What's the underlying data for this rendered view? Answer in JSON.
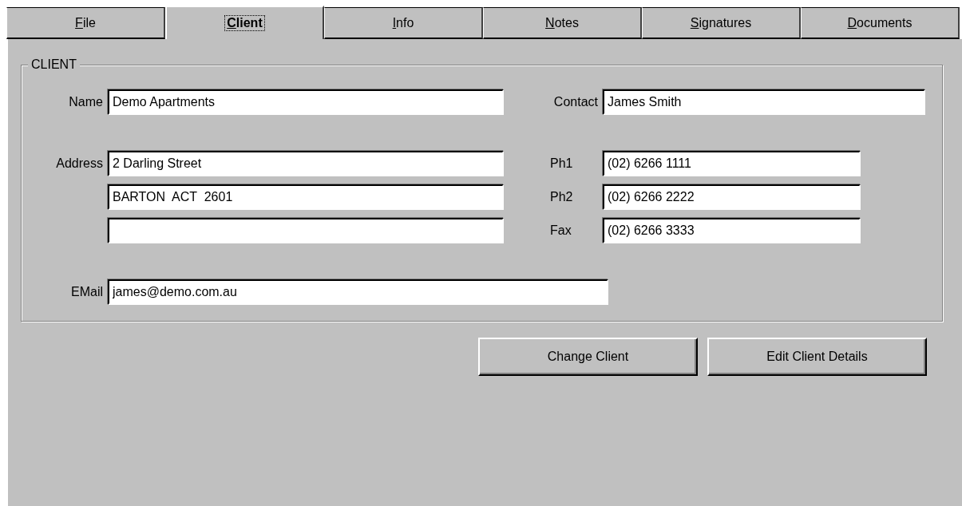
{
  "tabs": [
    {
      "label": "File",
      "selected": false
    },
    {
      "label": "Client",
      "selected": true
    },
    {
      "label": "Info",
      "selected": false
    },
    {
      "label": "Notes",
      "selected": false
    },
    {
      "label": "Signatures",
      "selected": false
    },
    {
      "label": "Documents",
      "selected": false
    }
  ],
  "group": {
    "title": "CLIENT",
    "name": {
      "label": "Name",
      "value": "Demo Apartments"
    },
    "contact": {
      "label": "Contact",
      "value": "James Smith"
    },
    "address": {
      "label": "Address",
      "lines": [
        {
          "kind": "filled",
          "value": "2 Darling Street"
        },
        {
          "kind": "filled",
          "value": "BARTON  ACT  2601"
        },
        {
          "kind": "blank"
        }
      ]
    },
    "phones": [
      {
        "label": "Ph1",
        "value": "(02) 6266 1111"
      },
      {
        "label": "Ph2",
        "value": "(02) 6266 2222"
      },
      {
        "label": "Fax",
        "value": "(02) 6266 3333"
      }
    ],
    "email": {
      "label": "EMail",
      "value": "james@demo.com.au"
    }
  },
  "buttons": [
    "Change Client",
    "Edit Client Details"
  ]
}
